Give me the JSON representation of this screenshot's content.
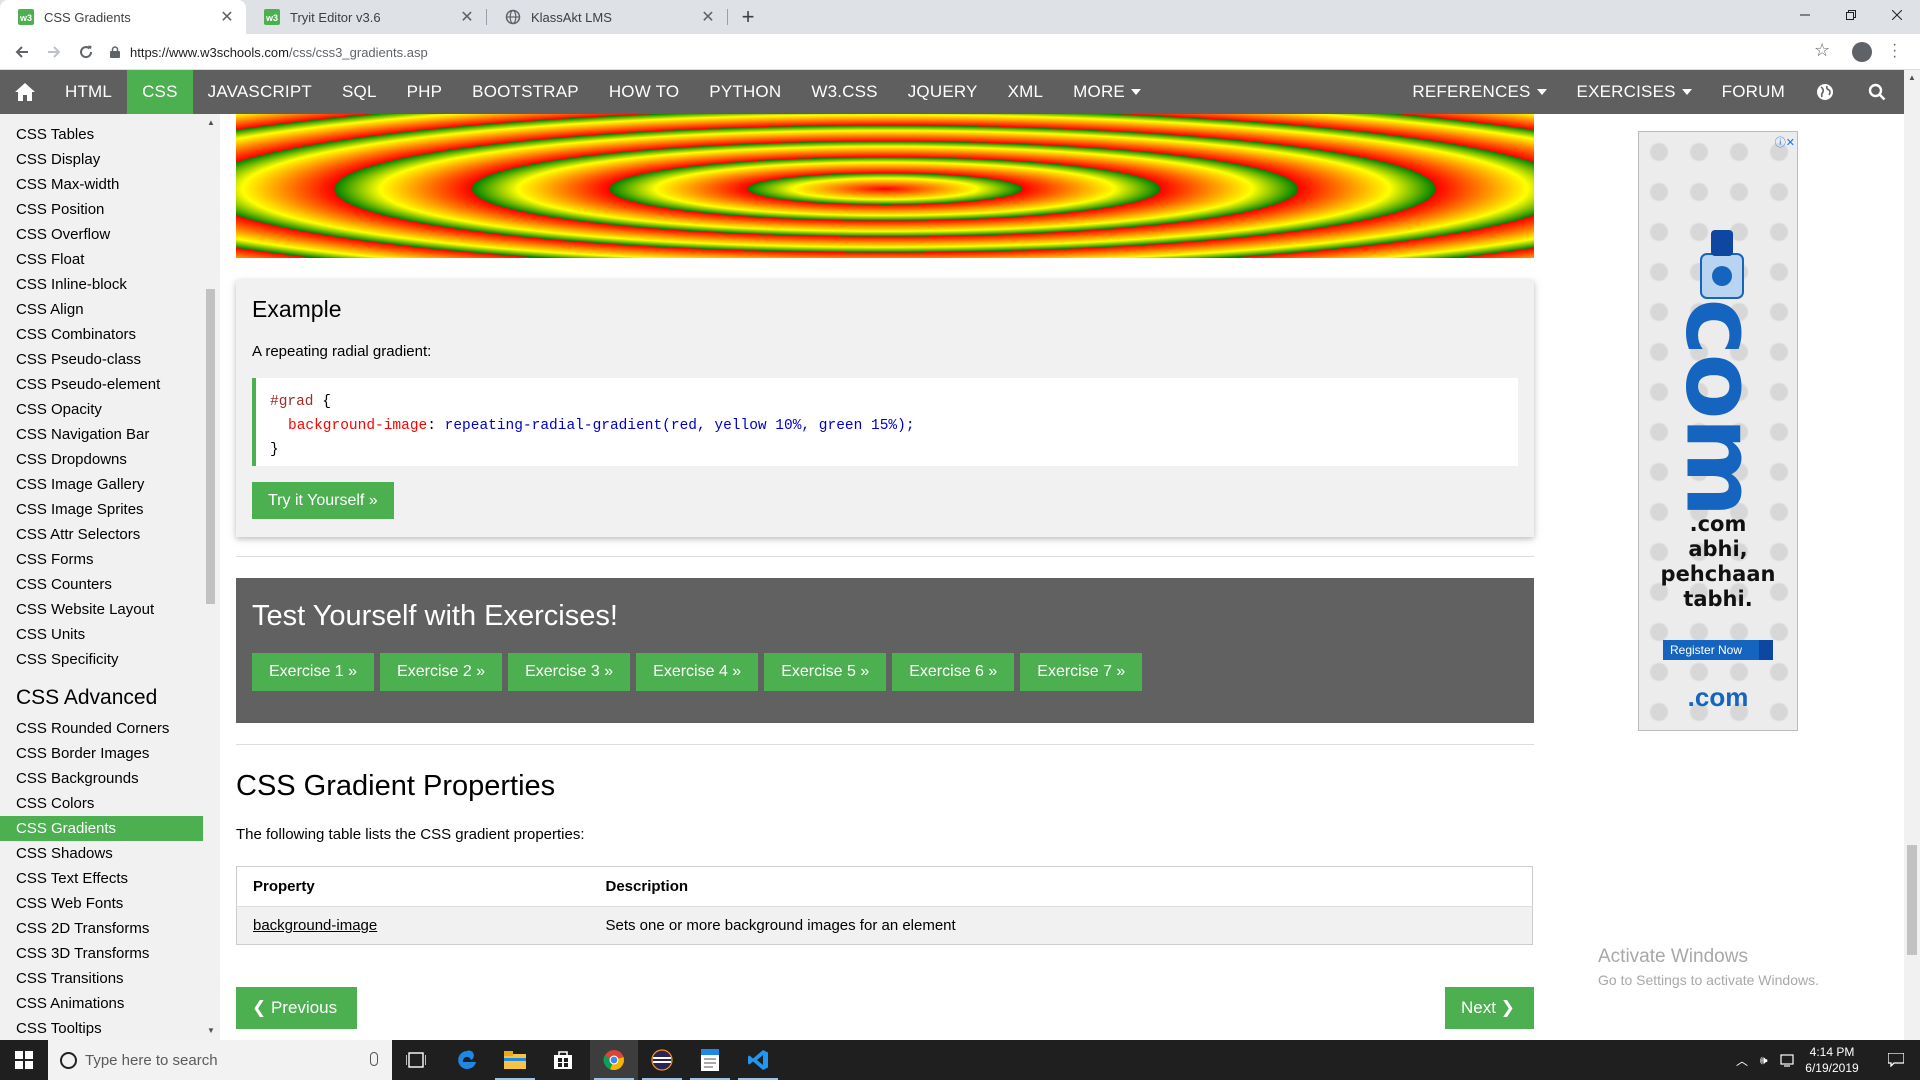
{
  "browser": {
    "tabs": [
      {
        "title": "CSS Gradients",
        "active": true
      },
      {
        "title": "Tryit Editor v3.6",
        "active": false
      },
      {
        "title": "KlassAkt LMS",
        "active": false
      }
    ],
    "url_host": "https://www.w3schools.com",
    "url_path": "/css/css3_gradients.asp"
  },
  "topnav": {
    "left": [
      "HTML",
      "CSS",
      "JAVASCRIPT",
      "SQL",
      "PHP",
      "BOOTSTRAP",
      "HOW TO",
      "PYTHON",
      "W3.CSS",
      "JQUERY",
      "XML",
      "MORE"
    ],
    "active": "CSS",
    "right": [
      "REFERENCES",
      "EXERCISES",
      "FORUM"
    ]
  },
  "sidebar": {
    "items_top": [
      "CSS Tables",
      "CSS Display",
      "CSS Max-width",
      "CSS Position",
      "CSS Overflow",
      "CSS Float",
      "CSS Inline-block",
      "CSS Align",
      "CSS Combinators",
      "CSS Pseudo-class",
      "CSS Pseudo-element",
      "CSS Opacity",
      "CSS Navigation Bar",
      "CSS Dropdowns",
      "CSS Image Gallery",
      "CSS Image Sprites",
      "CSS Attr Selectors",
      "CSS Forms",
      "CSS Counters",
      "CSS Website Layout",
      "CSS Units",
      "CSS Specificity"
    ],
    "advanced_heading": "CSS Advanced",
    "items_advanced": [
      "CSS Rounded Corners",
      "CSS Border Images",
      "CSS Backgrounds",
      "CSS Colors",
      "CSS Gradients",
      "CSS Shadows",
      "CSS Text Effects",
      "CSS Web Fonts",
      "CSS 2D Transforms",
      "CSS 3D Transforms",
      "CSS Transitions",
      "CSS Animations",
      "CSS Tooltips"
    ],
    "active": "CSS Gradients"
  },
  "example": {
    "heading": "Example",
    "description": "A repeating radial gradient:",
    "code_selector": "#grad",
    "code_open": " {",
    "code_property": "background-image",
    "code_colon": ": ",
    "code_value": "repeating-radial-gradient(red, yellow 10%, green 15%);",
    "code_close": "}",
    "button": "Try it Yourself »"
  },
  "exercises": {
    "heading": "Test Yourself with Exercises!",
    "buttons": [
      "Exercise 1 »",
      "Exercise 2 »",
      "Exercise 3 »",
      "Exercise 4 »",
      "Exercise 5 »",
      "Exercise 6 »",
      "Exercise 7 »"
    ]
  },
  "properties": {
    "heading": "CSS Gradient Properties",
    "intro": "The following table lists the CSS gradient properties:",
    "columns": [
      "Property",
      "Description"
    ],
    "rows": [
      {
        "property": "background-image",
        "description": "Sets one or more background images for an element"
      }
    ]
  },
  "pager": {
    "previous": "❮ Previous",
    "next": "Next ❯"
  },
  "ad": {
    "big_text": "com",
    "tagline_1": ".com",
    "tagline_2": "abhi,",
    "tagline_3": "pehchaan",
    "tagline_4": "tabhi.",
    "register": "Register Now",
    "logo": ".com"
  },
  "watermark": {
    "line1": "Activate Windows",
    "line2": "Go to Settings to activate Windows."
  },
  "taskbar": {
    "search_placeholder": "Type here to search",
    "time": "4:14 PM",
    "date": "6/19/2019"
  },
  "colors": {
    "w3_green": "#4caf50",
    "nav_gray": "#5f5f5f",
    "exercise_gray": "#616161"
  }
}
